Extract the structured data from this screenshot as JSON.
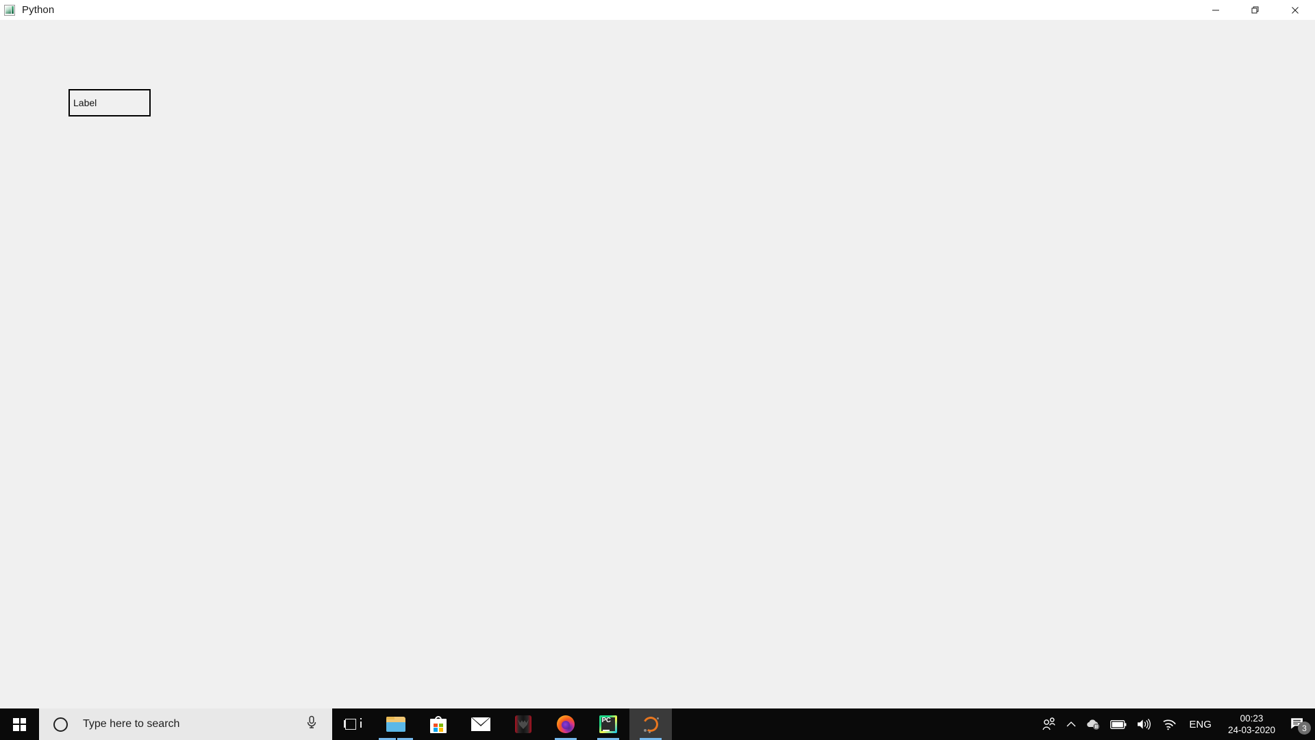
{
  "window": {
    "title": "Python",
    "icon": "tkinter-window-icon",
    "controls": {
      "minimize": "minimize-button",
      "maximize": "restore-button",
      "close": "close-button"
    }
  },
  "content": {
    "label_widget": {
      "text": "Label"
    }
  },
  "taskbar": {
    "start": "start-button",
    "search": {
      "placeholder": "Type here to search",
      "cortana": "cortana-ring-icon",
      "mic": "microphone-icon"
    },
    "apps": [
      {
        "name": "task-view",
        "label": "Task View",
        "state": "idle",
        "underline": "none"
      },
      {
        "name": "file-explorer",
        "label": "File Explorer",
        "state": "open",
        "underline": "double"
      },
      {
        "name": "microsoft-store",
        "label": "Microsoft Store",
        "state": "idle",
        "underline": "none"
      },
      {
        "name": "mail",
        "label": "Mail",
        "state": "idle",
        "underline": "none"
      },
      {
        "name": "predator-sense",
        "label": "Predator Sense",
        "state": "idle",
        "underline": "none"
      },
      {
        "name": "firefox",
        "label": "Firefox",
        "state": "open",
        "underline": "single"
      },
      {
        "name": "pycharm",
        "label": "PyCharm",
        "state": "open",
        "underline": "single"
      },
      {
        "name": "python-app",
        "label": "Python",
        "state": "active",
        "underline": "single"
      }
    ],
    "tray": {
      "people": "people-icon",
      "show_hidden": "chevron-up-icon",
      "onedrive": "onedrive-paused-icon",
      "battery": "battery-icon",
      "volume": "volume-icon",
      "network": "wifi-icon",
      "language": "ENG",
      "time": "00:23",
      "date": "24-03-2020",
      "action_center": "notifications-icon",
      "notification_count": "3"
    }
  },
  "colors": {
    "titlebar_bg": "#ffffff",
    "client_bg": "#f0f0f0",
    "taskbar_bg": "#0a0a0a",
    "search_bg": "#e8e8e8",
    "accent_underline": "#76b9ed",
    "label_border": "#000000"
  }
}
